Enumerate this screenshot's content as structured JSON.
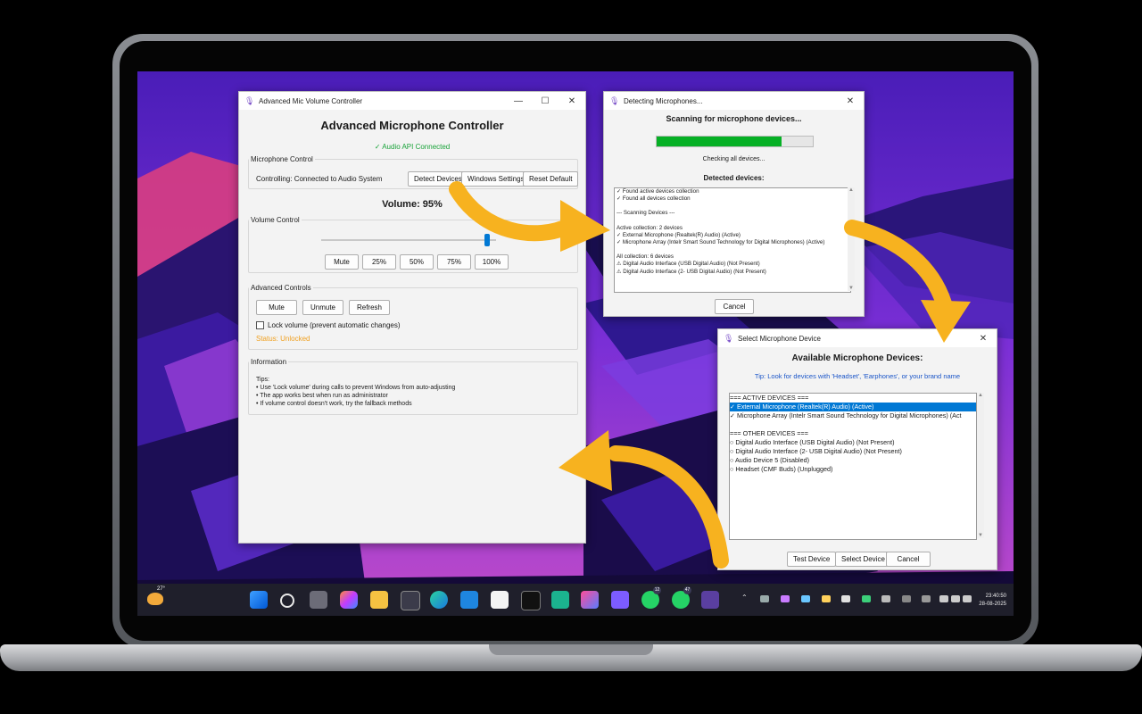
{
  "main_window": {
    "title": "Advanced Mic Volume Controller",
    "heading": "Advanced Microphone Controller",
    "api_status": "✓ Audio API Connected",
    "mic_control": {
      "legend": "Microphone Control",
      "controlling_text": "Controlling: Connected to Audio System",
      "detect_label": "Detect Devices",
      "windows_settings_label": "Windows Settings",
      "reset_label": "Reset Default"
    },
    "volume_display": "Volume: 95%",
    "volume_level": 0.95,
    "volume_control": {
      "legend": "Volume Control",
      "presets": [
        "Mute",
        "25%",
        "50%",
        "75%",
        "100%"
      ]
    },
    "advanced": {
      "legend": "Advanced Controls",
      "buttons": [
        "Mute",
        "Unmute",
        "Refresh"
      ],
      "lock_label": "Lock volume (prevent automatic changes)",
      "status": "Status: Unlocked"
    },
    "information": {
      "legend": "Information",
      "tips_title": "Tips:",
      "tips": [
        "• Use 'Lock volume' during calls to prevent Windows from auto-adjusting",
        "• The app works best when run as administrator",
        "• If volume control doesn't work, try the fallback methods"
      ]
    }
  },
  "detect_window": {
    "title": "Detecting Microphones...",
    "heading": "Scanning for microphone devices...",
    "progress": 0.8,
    "progress_color": "#06b025",
    "status": "Checking all devices...",
    "detected_label": "Detected devices:",
    "log": [
      "✓ Found active devices collection",
      "✓ Found all devices collection",
      "",
      "--- Scanning Devices ---",
      "",
      "Active collection: 2 devices",
      "  ✓ External Microphone (Realtek(R) Audio) (Active)",
      "  ✓ Microphone Array (Intelr Smart Sound Technology for Digital Microphones) (Active)",
      "",
      "All collection: 6 devices",
      "  ⚠ Digital Audio Interface (USB Digital Audio) (Not Present)",
      "  ⚠ Digital Audio Interface (2- USB Digital Audio) (Not Present)"
    ],
    "cancel_label": "Cancel"
  },
  "select_window": {
    "title": "Select Microphone Device",
    "heading": "Available Microphone Devices:",
    "tip": "Tip: Look for devices with 'Headset', 'Earphones', or your brand name",
    "items": [
      "=== ACTIVE DEVICES ===",
      "✓ External Microphone (Realtek(R) Audio) (Active)",
      "✓ Microphone Array (Intelr Smart Sound Technology for Digital Microphones) (Act",
      "",
      "=== OTHER DEVICES ===",
      "○ Digital Audio Interface (USB Digital Audio) (Not Present)",
      "○ Digital Audio Interface (2- USB Digital Audio) (Not Present)",
      "○ Audio Device 5 (Disabled)",
      "○ Headset (CMF Buds) (Unplugged)"
    ],
    "selected_index": 1,
    "test_label": "Test Device",
    "select_label": "Select Device",
    "cancel_label": "Cancel"
  },
  "taskbar": {
    "weather": "27°",
    "time": "23:40:50",
    "date": "28-08-2025",
    "badges": [
      "12",
      "47"
    ]
  },
  "colors": {
    "accent": "#0078d4",
    "connected_green": "#1aa33a",
    "status_orange": "#f0a020",
    "tip_blue": "#1a55c8",
    "arrow_yellow": "#f7b21f"
  }
}
